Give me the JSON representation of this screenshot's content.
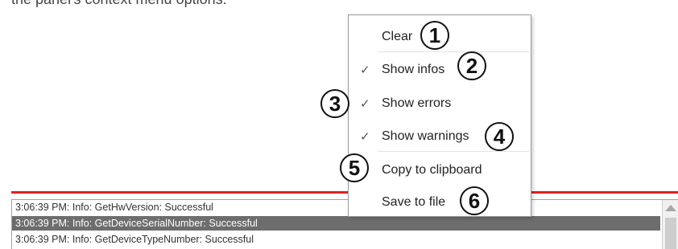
{
  "intro": {
    "text": "the panel's context menu options:"
  },
  "menu": {
    "items": [
      {
        "label": "Clear",
        "checked": "",
        "callout": "1"
      },
      {
        "label": "Show infos",
        "checked": "✓",
        "callout": "2"
      },
      {
        "label": "Show errors",
        "checked": "✓",
        "callout": "3"
      },
      {
        "label": "Show warnings",
        "checked": "✓",
        "callout": "4"
      },
      {
        "label": "Copy to clipboard",
        "checked": "",
        "callout": "5"
      },
      {
        "label": "Save to file",
        "checked": "",
        "callout": "6"
      }
    ]
  },
  "log": {
    "rows": [
      {
        "text": "3:06:39 PM: Info: GetHwVersion: Successful",
        "selected": false
      },
      {
        "text": "3:06:39 PM: Info: GetDeviceSerialNumber: Successful",
        "selected": true
      },
      {
        "text": "3:06:39 PM: Info: GetDeviceTypeNumber: Successful",
        "selected": false
      }
    ]
  },
  "colors": {
    "accent_line": "#e02020",
    "selection": "#6d6d6d"
  }
}
